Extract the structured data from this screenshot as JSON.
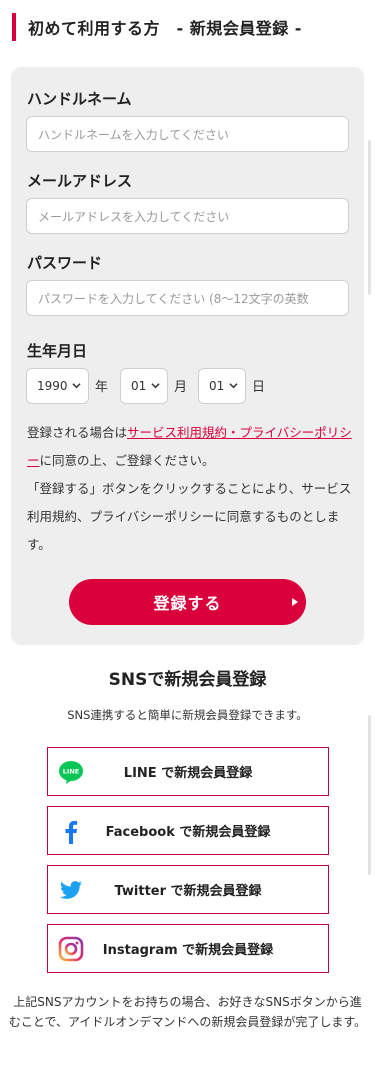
{
  "header": {
    "title": "初めて利用する方　- 新規会員登録 -"
  },
  "form": {
    "handle_label": "ハンドルネーム",
    "handle_placeholder": "ハンドルネームを入力してください",
    "email_label": "メールアドレス",
    "email_placeholder": "メールアドレスを入力してください",
    "password_label": "パスワード",
    "password_placeholder": "パスワードを入力してください (8〜12文字の英数",
    "birthday_label": "生年月日",
    "year_value": "1990",
    "year_unit": "年",
    "month_value": "01",
    "month_unit": "月",
    "day_value": "01",
    "day_unit": "日",
    "terms_prefix": "登録される場合は",
    "terms_link": "サービス利用規約・プライバシーポリシー",
    "terms_suffix": "に同意の上、ご登録ください。",
    "terms_note": "「登録する」ボタンをクリックすることにより、サービス利用規約、プライバシーポリシーに同意するものとします。",
    "submit_label": "登録する"
  },
  "sns": {
    "title": "SNSで新規会員登録",
    "subtitle": "SNS連携すると簡単に新規会員登録できます。",
    "line_icon_text": "LINE",
    "buttons": [
      {
        "label": "LINE で新規会員登録",
        "icon": "line-icon",
        "color": "#06c755"
      },
      {
        "label": "Facebook で新規会員登録",
        "icon": "facebook-icon",
        "color": "#1877f2"
      },
      {
        "label": "Twitter で新規会員登録",
        "icon": "twitter-icon",
        "color": "#1da1f2"
      },
      {
        "label": "Instagram で新規会員登録",
        "icon": "instagram-icon",
        "color": "#e1306c"
      }
    ],
    "footer_note": "上記SNSアカウントをお持ちの場合、お好きなSNSボタンから進むことで、アイドルオンデマンドへの新規会員登録が完了します。"
  },
  "colors": {
    "accent": "#d9003b",
    "card_bg": "#eeeeee",
    "sns_border": "#c4003a"
  }
}
